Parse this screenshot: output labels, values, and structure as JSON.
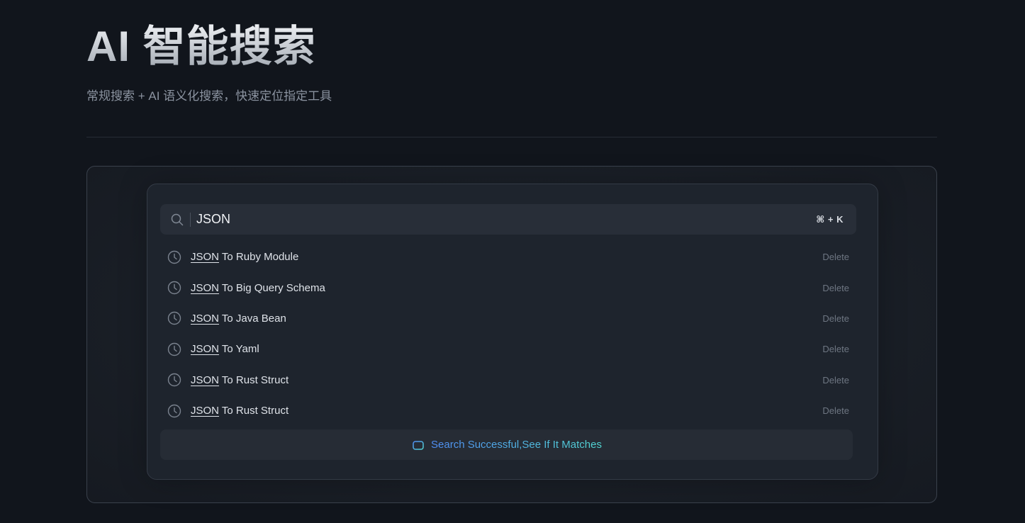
{
  "header": {
    "title": "AI 智能搜索",
    "subtitle": "常规搜索 + AI 语义化搜索，快速定位指定工具"
  },
  "search": {
    "value": "JSON",
    "placeholder": "",
    "shortcut": "⌘ + K",
    "icon": "search-icon"
  },
  "results": [
    {
      "match": "JSON",
      "rest": " To Ruby Module",
      "delete_label": "Delete",
      "icon": "clock-icon"
    },
    {
      "match": "JSON",
      "rest": " To Big Query Schema",
      "delete_label": "Delete",
      "icon": "clock-icon"
    },
    {
      "match": "JSON",
      "rest": " To Java Bean",
      "delete_label": "Delete",
      "icon": "clock-icon"
    },
    {
      "match": "JSON",
      "rest": " To Yaml",
      "delete_label": "Delete",
      "icon": "clock-icon"
    },
    {
      "match": "JSON",
      "rest": " To Rust Struct",
      "delete_label": "Delete",
      "icon": "clock-icon"
    },
    {
      "match": "JSON",
      "rest": " To Rust Struct",
      "delete_label": "Delete",
      "icon": "clock-icon"
    }
  ],
  "status": {
    "text": "Search Successful,See If It Matches",
    "icon": "ai-robot-icon"
  },
  "colors": {
    "background": "#11151c",
    "card": "#1e242d",
    "accent_start": "#4f8df5",
    "accent_end": "#52d6d2"
  }
}
